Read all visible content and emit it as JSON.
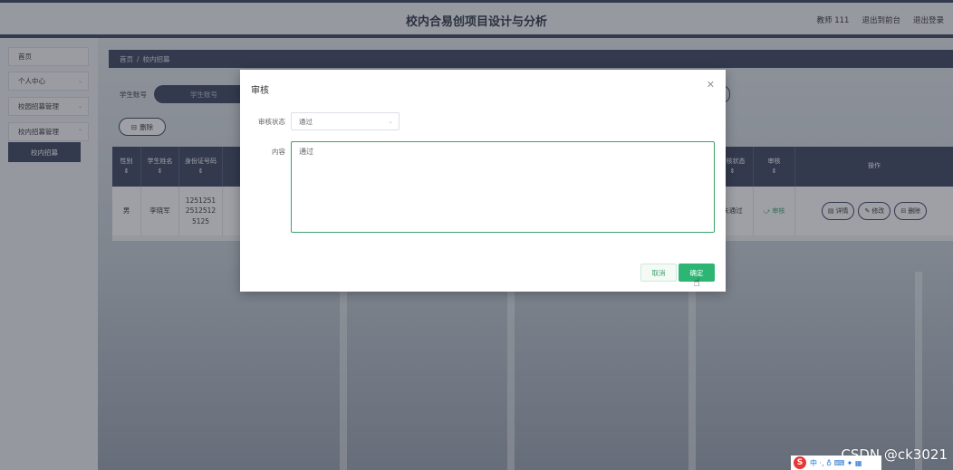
{
  "header": {
    "title": "校内合易创项目设计与分析",
    "user": "教师 111",
    "back_home": "退出到前台",
    "logout": "退出登录"
  },
  "sidebar": {
    "items": [
      "首页",
      "个人中心",
      "校园招募管理",
      "校内招募管理"
    ],
    "sub_item": "校内招募"
  },
  "breadcrumb": {
    "home": "首页",
    "sep": "/",
    "current": "校内招募"
  },
  "search": {
    "label": "学生账号",
    "placeholder": "学生账号"
  },
  "toolbar": {
    "delete_label": "删除"
  },
  "table": {
    "headers": [
      "性别",
      "学生姓名",
      "身份证号码",
      "审核状态",
      "审核",
      "操作"
    ],
    "row": {
      "gender": "男",
      "name": "李晓军",
      "id_number": "1251251 2512512 5125",
      "status": "未通过",
      "audit": "审核",
      "detail": "详情",
      "edit": "修改",
      "delete": "删除"
    }
  },
  "dialog": {
    "title": "审核",
    "status_label": "审核状态",
    "status_value": "通过",
    "content_label": "内容",
    "content_value": "通过",
    "cancel": "取消",
    "confirm": "确定"
  },
  "watermark": "CSDN @ck3021",
  "colors": {
    "primary": "#3d4662",
    "accent": "#2db574"
  }
}
